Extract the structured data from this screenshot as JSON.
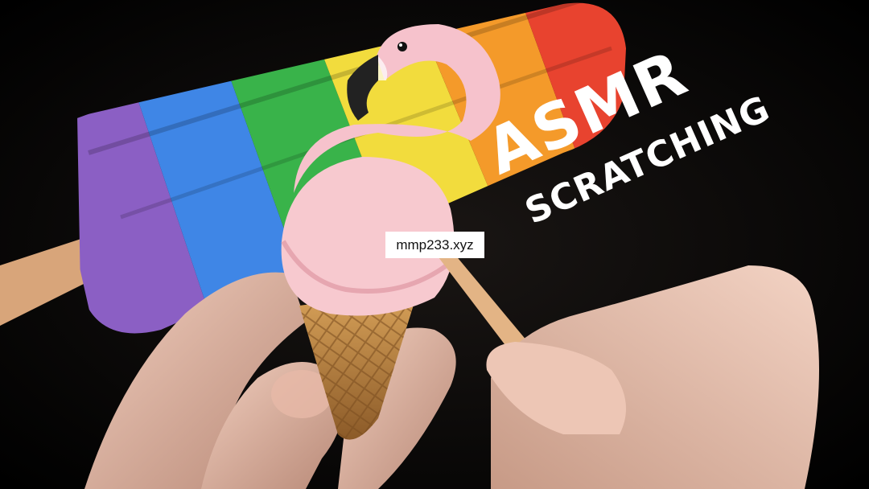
{
  "overlay": {
    "title_main": "ASMR",
    "title_sub": "SCRATCHING",
    "watermark": "mmp233.xyz"
  },
  "colors": {
    "background": "#000000",
    "title_text": "#ffffff",
    "popsicle_stripes": [
      "#8b5fc4",
      "#3f86e6",
      "#39b34a",
      "#f2dc3d",
      "#f49a2a",
      "#e8432f"
    ],
    "flamingo": "#f6c2cc",
    "ice_cream": "#f7c9cf",
    "cone": "#c98f44",
    "skin": "#e9c1ae"
  },
  "objects": [
    "rainbow-popsicle",
    "flamingo-figure",
    "ice-cream-cone",
    "left-hand",
    "right-hand",
    "wooden-stick"
  ]
}
